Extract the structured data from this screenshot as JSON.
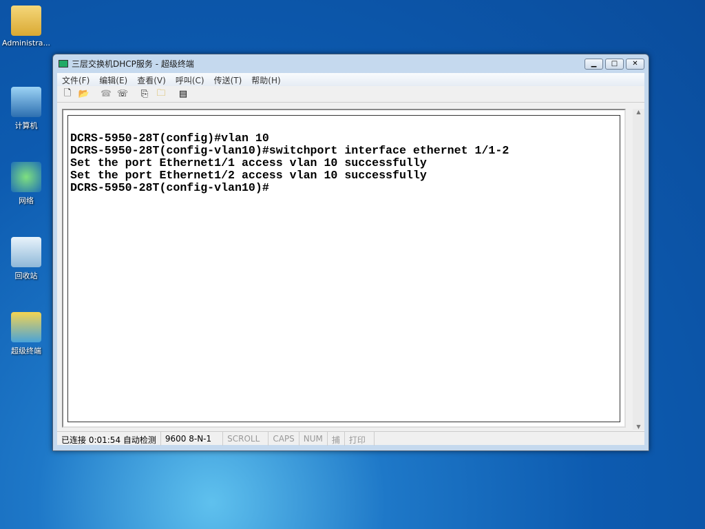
{
  "desktop": [
    "Administra...",
    "计算机",
    "网络",
    "回收站",
    "超级终端"
  ],
  "window": {
    "title": "三层交换机DHCP服务 - 超级终端",
    "controls": [
      "minimize",
      "maximize",
      "close"
    ]
  },
  "menu": [
    "文件(F)",
    "编辑(E)",
    "查看(V)",
    "呼叫(C)",
    "传送(T)",
    "帮助(H)"
  ],
  "toolbar": [
    "new-icon",
    "open-icon",
    "disconnect-icon",
    "dial-icon",
    "send-icon",
    "receive-icon",
    "properties-icon"
  ],
  "terminal": [
    "DCRS-5950-28T(config)#vlan 10",
    "DCRS-5950-28T(config-vlan10)#switchport interface ethernet 1/1-2",
    "Set the port Ethernet1/1 access vlan 10 successfully",
    "Set the port Ethernet1/2 access vlan 10 successfully",
    "DCRS-5950-28T(config-vlan10)#"
  ],
  "status": {
    "connection": "已连接 0:01:54 自动检测",
    "settings": "9600 8-N-1",
    "scroll": "SCROLL",
    "caps": "CAPS",
    "num": "NUM",
    "capture": "捕",
    "print": "打印"
  }
}
